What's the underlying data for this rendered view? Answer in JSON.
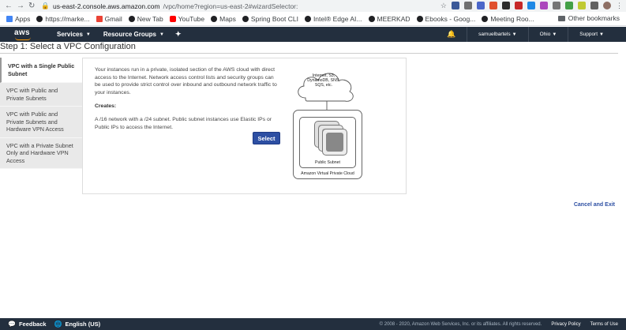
{
  "browser": {
    "url_host": "us-east-2.console.aws.amazon.com",
    "url_path": "/vpc/home?region=us-east-2#wizardSelector:"
  },
  "bookmarks": {
    "items": [
      {
        "label": "Apps",
        "color": "#4285f4"
      },
      {
        "label": "https://marke...",
        "color": "#202124"
      },
      {
        "label": "Gmail",
        "color": "#ea4335"
      },
      {
        "label": "New Tab",
        "color": "#202124"
      },
      {
        "label": "YouTube",
        "color": "#ff0000"
      },
      {
        "label": "Maps",
        "color": "#202124"
      },
      {
        "label": "Spring Boot CLI",
        "color": "#202124"
      },
      {
        "label": "Intel® Edge AI...",
        "color": "#202124"
      },
      {
        "label": "MEERKAD",
        "color": "#202124"
      },
      {
        "label": "Ebooks - Goog...",
        "color": "#202124"
      },
      {
        "label": "Meeting Roo...",
        "color": "#202124"
      }
    ],
    "other": "Other bookmarks"
  },
  "aws_nav": {
    "logo": "aws",
    "services": "Services",
    "resource_groups": "Resource Groups",
    "user": "samuelbartels",
    "region": "Ohio",
    "support": "Support"
  },
  "page": {
    "title": "Step 1: Select a VPC Configuration"
  },
  "options": [
    {
      "label": "VPC with a Single Public Subnet",
      "active": true
    },
    {
      "label": "VPC with Public and Private Subnets",
      "active": false
    },
    {
      "label": "VPC with Public and Private Subnets and Hardware VPN Access",
      "active": false
    },
    {
      "label": "VPC with a Private Subnet Only and Hardware VPN Access",
      "active": false
    }
  ],
  "detail": {
    "description": "Your instances run in a private, isolated section of the AWS cloud with direct access to the Internet. Network access control lists and security groups can be used to provide strict control over inbound and outbound network traffic to your instances.",
    "creates_heading": "Creates:",
    "creates_text": "A /16 network with a /24 subnet. Public subnet instances use Elastic IPs or Public IPs to access the Internet.",
    "select_label": "Select",
    "diagram": {
      "cloud_text": "Internet, S3, DynamoDB, SNS, SQS, etc.",
      "subnet_label": "Public Subnet",
      "vpc_label": "Amazon Virtual Private Cloud"
    }
  },
  "cancel_label": "Cancel and Exit",
  "footer": {
    "feedback": "Feedback",
    "language": "English (US)",
    "copyright": "© 2008 - 2020, Amazon Web Services, Inc. or its affiliates. All rights reserved.",
    "privacy": "Privacy Policy",
    "terms": "Terms of Use"
  }
}
